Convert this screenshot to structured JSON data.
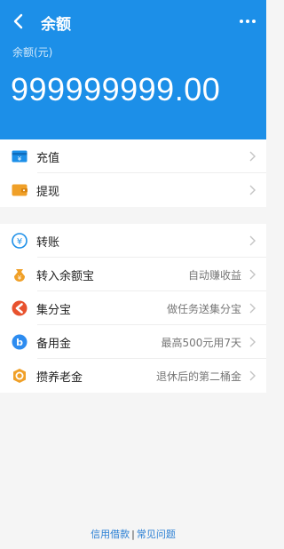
{
  "header": {
    "title": "余额",
    "balance_label": "余额(元)",
    "balance_amount": "999999999.00"
  },
  "section1": [
    {
      "label": "充值",
      "icon": "recharge-icon"
    },
    {
      "label": "提现",
      "icon": "withdraw-icon"
    }
  ],
  "section2": [
    {
      "label": "转账",
      "hint": "",
      "icon": "transfer-icon"
    },
    {
      "label": "转入余额宝",
      "hint": "自动赚收益",
      "icon": "yuebao-icon"
    },
    {
      "label": "集分宝",
      "hint": "做任务送集分宝",
      "icon": "jifenbao-icon"
    },
    {
      "label": "备用金",
      "hint": "最高500元用7天",
      "icon": "reserve-fund-icon"
    },
    {
      "label": "攒养老金",
      "hint": "退休后的第二桶金",
      "icon": "pension-icon"
    }
  ],
  "footer": {
    "link1": "信用借款",
    "separator": "|",
    "link2": "常见问题"
  },
  "colors": {
    "header_bg": "#1c8fe8",
    "link": "#2a7fd4"
  }
}
